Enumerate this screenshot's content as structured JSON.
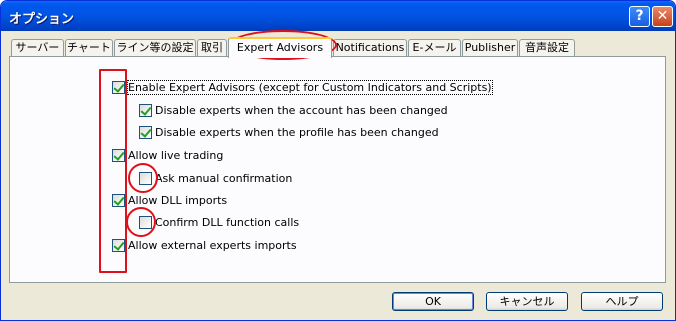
{
  "window": {
    "title": "オプション",
    "help_glyph": "?",
    "close_glyph": "✕"
  },
  "tabs": [
    {
      "label": "サーバー"
    },
    {
      "label": "チャート"
    },
    {
      "label": "ライン等の設定"
    },
    {
      "label": "取引"
    },
    {
      "label": "Expert Advisors",
      "active": true
    },
    {
      "label": "Notifications"
    },
    {
      "label": "E-メール"
    },
    {
      "label": "Publisher"
    },
    {
      "label": "音声設定"
    }
  ],
  "options": [
    {
      "label": "Enable Expert Advisors (except for Custom Indicators and Scripts)",
      "checked": true
    },
    {
      "label": "Disable experts when the account has been changed",
      "checked": true
    },
    {
      "label": "Disable experts when the profile has been changed",
      "checked": true
    },
    {
      "label": "Allow live trading",
      "checked": true
    },
    {
      "label": "Ask manual confirmation",
      "checked": false
    },
    {
      "label": "Allow DLL imports",
      "checked": true
    },
    {
      "label": "Confirm DLL function calls",
      "checked": false
    },
    {
      "label": "Allow external experts imports",
      "checked": true
    }
  ],
  "buttons": {
    "ok": "OK",
    "cancel": "キャンセル",
    "help": "ヘルプ"
  },
  "colors": {
    "annotation": "#e0101a",
    "titlebar": "#0054e3",
    "check": "#21a121"
  }
}
